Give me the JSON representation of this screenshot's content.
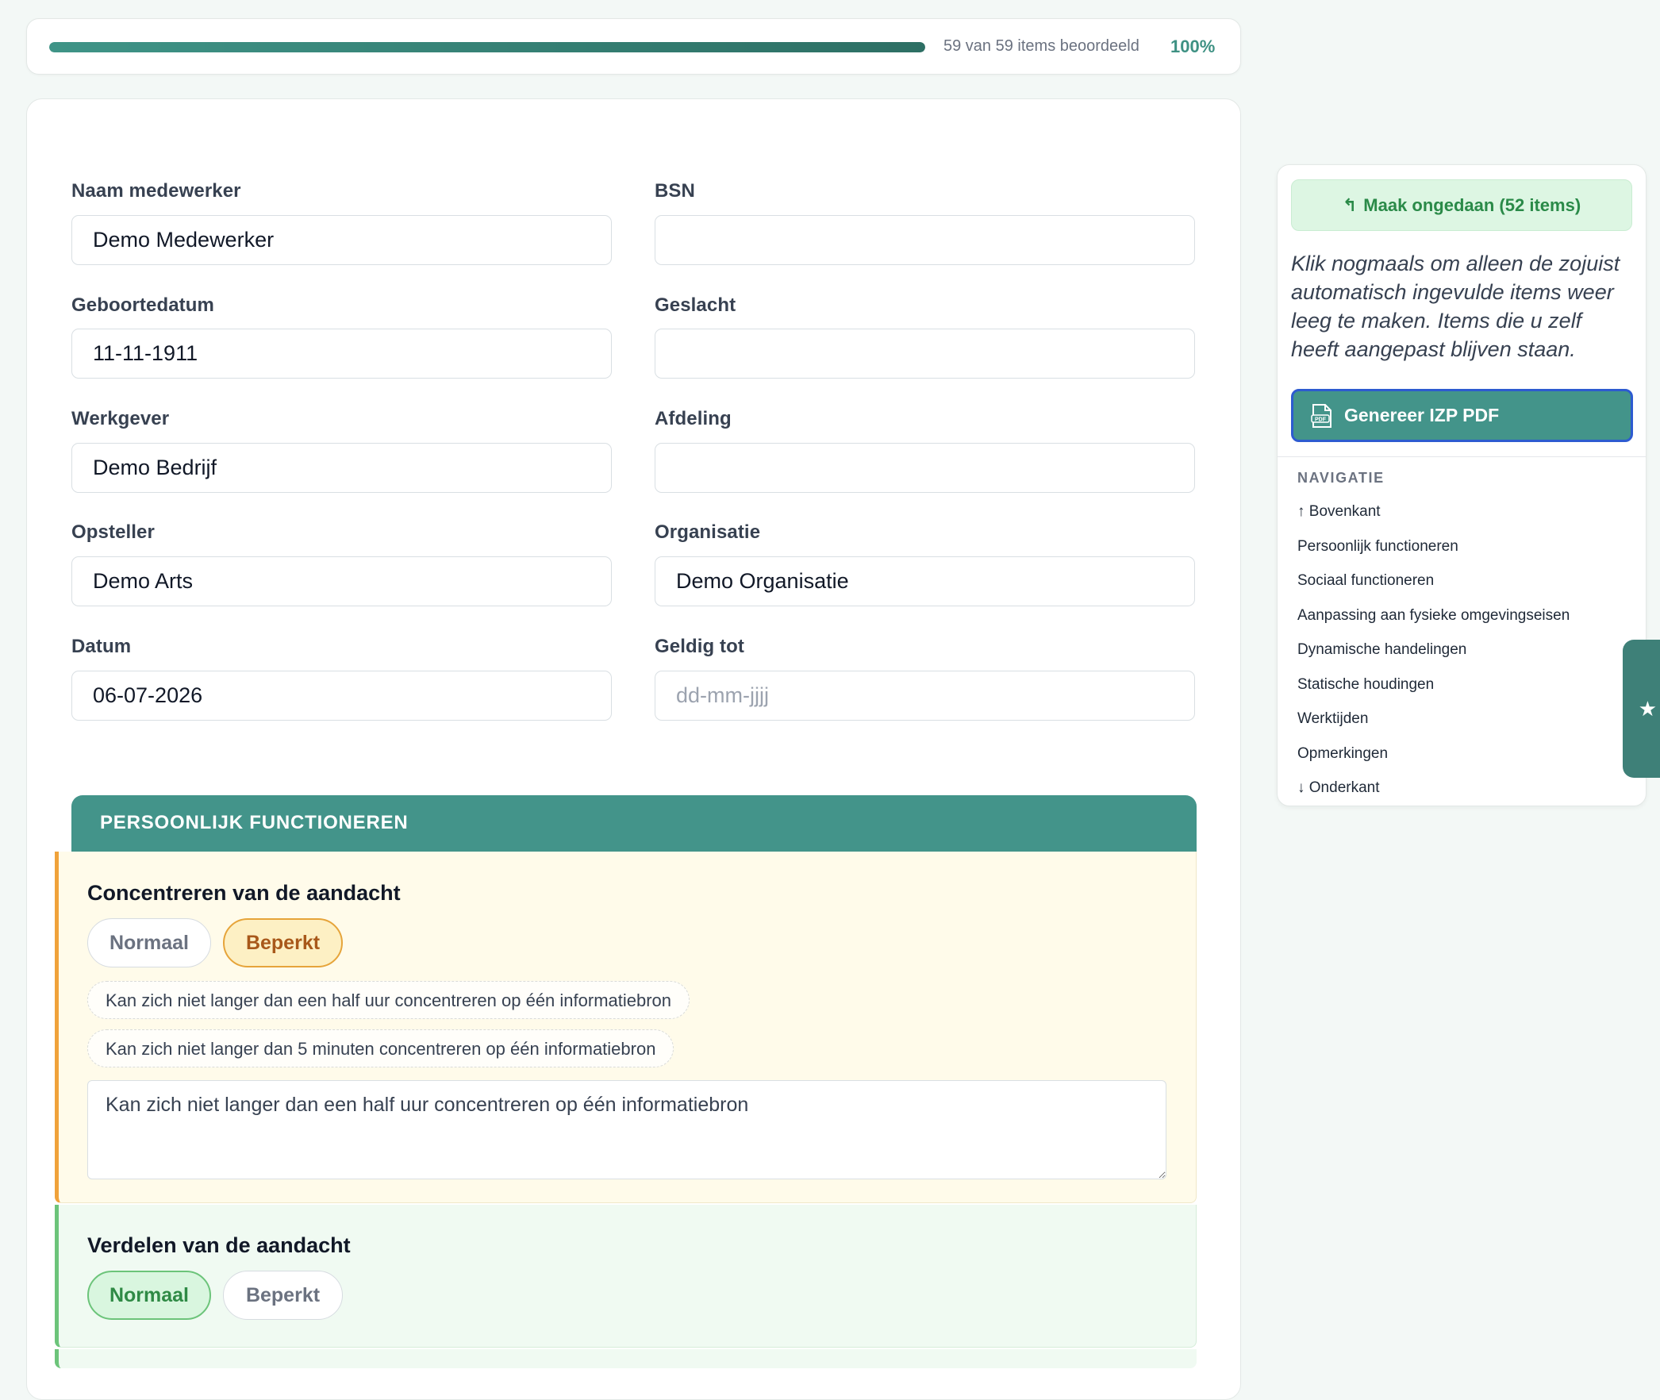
{
  "progress": {
    "text": "59 van 59 items beoordeeld",
    "percent_label": "100%",
    "fraction": 1.0,
    "color": "#43948a"
  },
  "form": {
    "naam": {
      "label": "Naam medewerker",
      "value": "Demo Medewerker"
    },
    "bsn": {
      "label": "BSN",
      "value": ""
    },
    "geboortedatum": {
      "label": "Geboortedatum",
      "value": "11-11-1911"
    },
    "geslacht": {
      "label": "Geslacht",
      "value": ""
    },
    "werkgever": {
      "label": "Werkgever",
      "value": "Demo Bedrijf"
    },
    "afdeling": {
      "label": "Afdeling",
      "value": ""
    },
    "opsteller": {
      "label": "Opsteller",
      "value": "Demo Arts"
    },
    "organisatie": {
      "label": "Organisatie",
      "value": "Demo Organisatie"
    },
    "datum": {
      "label": "Datum",
      "value": "06-07-2026"
    },
    "geldig_tot": {
      "label": "Geldig tot",
      "value": "",
      "placeholder": "dd-mm-jjjj"
    }
  },
  "section": {
    "title": "PERSOONLIJK FUNCTIONEREN",
    "color": "#43948a",
    "items": [
      {
        "title": "Concentreren van de aandacht",
        "status": "Beperkt",
        "options": [
          "Normaal",
          "Beperkt"
        ],
        "suggestions": [
          "Kan zich niet langer dan een half uur concentreren op één informatiebron",
          "Kan zich niet langer dan 5 minuten concentreren op één informatiebron"
        ],
        "note": "Kan zich niet langer dan een half uur concentreren op één informatiebron"
      },
      {
        "title": "Verdelen van de aandacht",
        "status": "Normaal",
        "options": [
          "Normaal",
          "Beperkt"
        ]
      }
    ]
  },
  "sidebar": {
    "undo_label": "Maak ongedaan (52 items)",
    "undo_icon": "undo-arrow",
    "help_text": "Klik nogmaals om alleen de zojuist automatisch ingevulde items weer leeg te maken. Items die u zelf heeft aangepast blijven staan.",
    "pdf_label": "Genereer IZP PDF",
    "pdf_icon": "pdf-file",
    "nav_heading": "NAVIGATIE",
    "nav_items": [
      "↑ Bovenkant",
      "Persoonlijk functioneren",
      "Sociaal functioneren",
      "Aanpassing aan fysieke omgevingseisen",
      "Dynamische handelingen",
      "Statische houdingen",
      "Werktijden",
      "Opmerkingen",
      "↓ Onderkant"
    ]
  },
  "side_tab": {
    "icon": "star",
    "glyph": "★"
  }
}
